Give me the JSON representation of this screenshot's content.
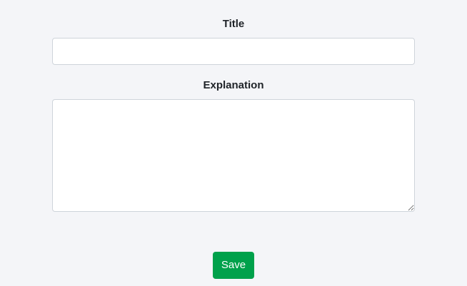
{
  "form": {
    "title_label": "Title",
    "title_value": "",
    "explanation_label": "Explanation",
    "explanation_value": ""
  },
  "actions": {
    "save_label": "Save"
  },
  "colors": {
    "background": "#f4f5f8",
    "save_button": "#00a14b",
    "input_border": "#ced4da"
  }
}
